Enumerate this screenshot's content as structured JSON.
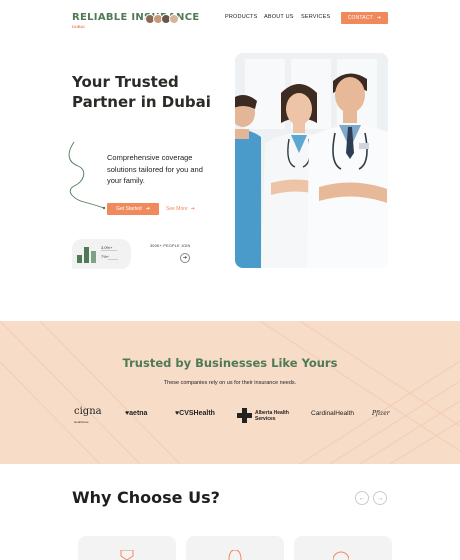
{
  "header": {
    "logo_main": "RELIABLE INSURANCE",
    "logo_sub": "DUBAI",
    "nav": [
      "PRODUCTS",
      "ABOUT US",
      "SERVICES"
    ],
    "contact_label": "CONTACT",
    "contact_arrow": "➔"
  },
  "hero": {
    "title": "Your Trusted Partner in Dubai",
    "description": "Comprehensive coverage solutions tailored for you and your family.",
    "primary_label": "Get Started",
    "primary_arrow": "➔",
    "secondary_label": "See More",
    "secondary_arrow": "➔",
    "stat1": "3.0%+",
    "stat2": "7%+",
    "people_label": "300K+ PEOPLE JOIN",
    "people_arrow": "➔"
  },
  "trusted": {
    "title": "Trusted by Businesses Like Yours",
    "subtitle": "These companies rely on us for their insurance needs.",
    "brands": {
      "cigna": "cigna",
      "cigna_small": "Healthcare",
      "aetna": "aetna",
      "cvs": "CVSHealth",
      "alberta_1": "Alberta Health",
      "alberta_2": "Services",
      "cardinal": "CardinalHealth",
      "pfizer": "Pfizer"
    }
  },
  "why": {
    "title": "Why Choose Us?",
    "prev": "←",
    "next": "→"
  },
  "colors": {
    "accent": "#f08a5d",
    "brand_green": "#4e7a55",
    "band": "#f7dcc8"
  }
}
